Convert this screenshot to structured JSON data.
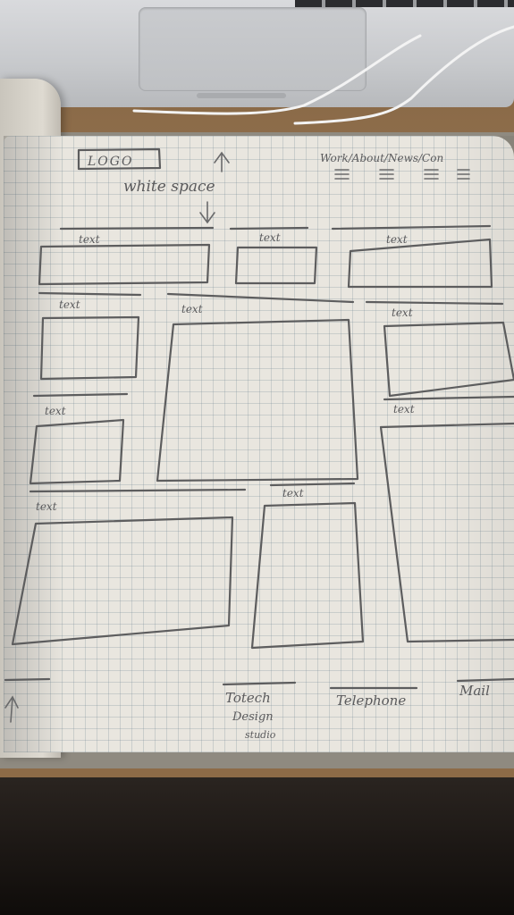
{
  "sketch": {
    "logo": "LOGO",
    "whitespace": "white space",
    "nav": "Work/About/News/Con",
    "text_label": "text",
    "footer": {
      "col1_line1": "Totech",
      "col1_line2": "Design",
      "col1_line3": "studio",
      "col2": "Telephone",
      "col3": "Mail"
    }
  }
}
